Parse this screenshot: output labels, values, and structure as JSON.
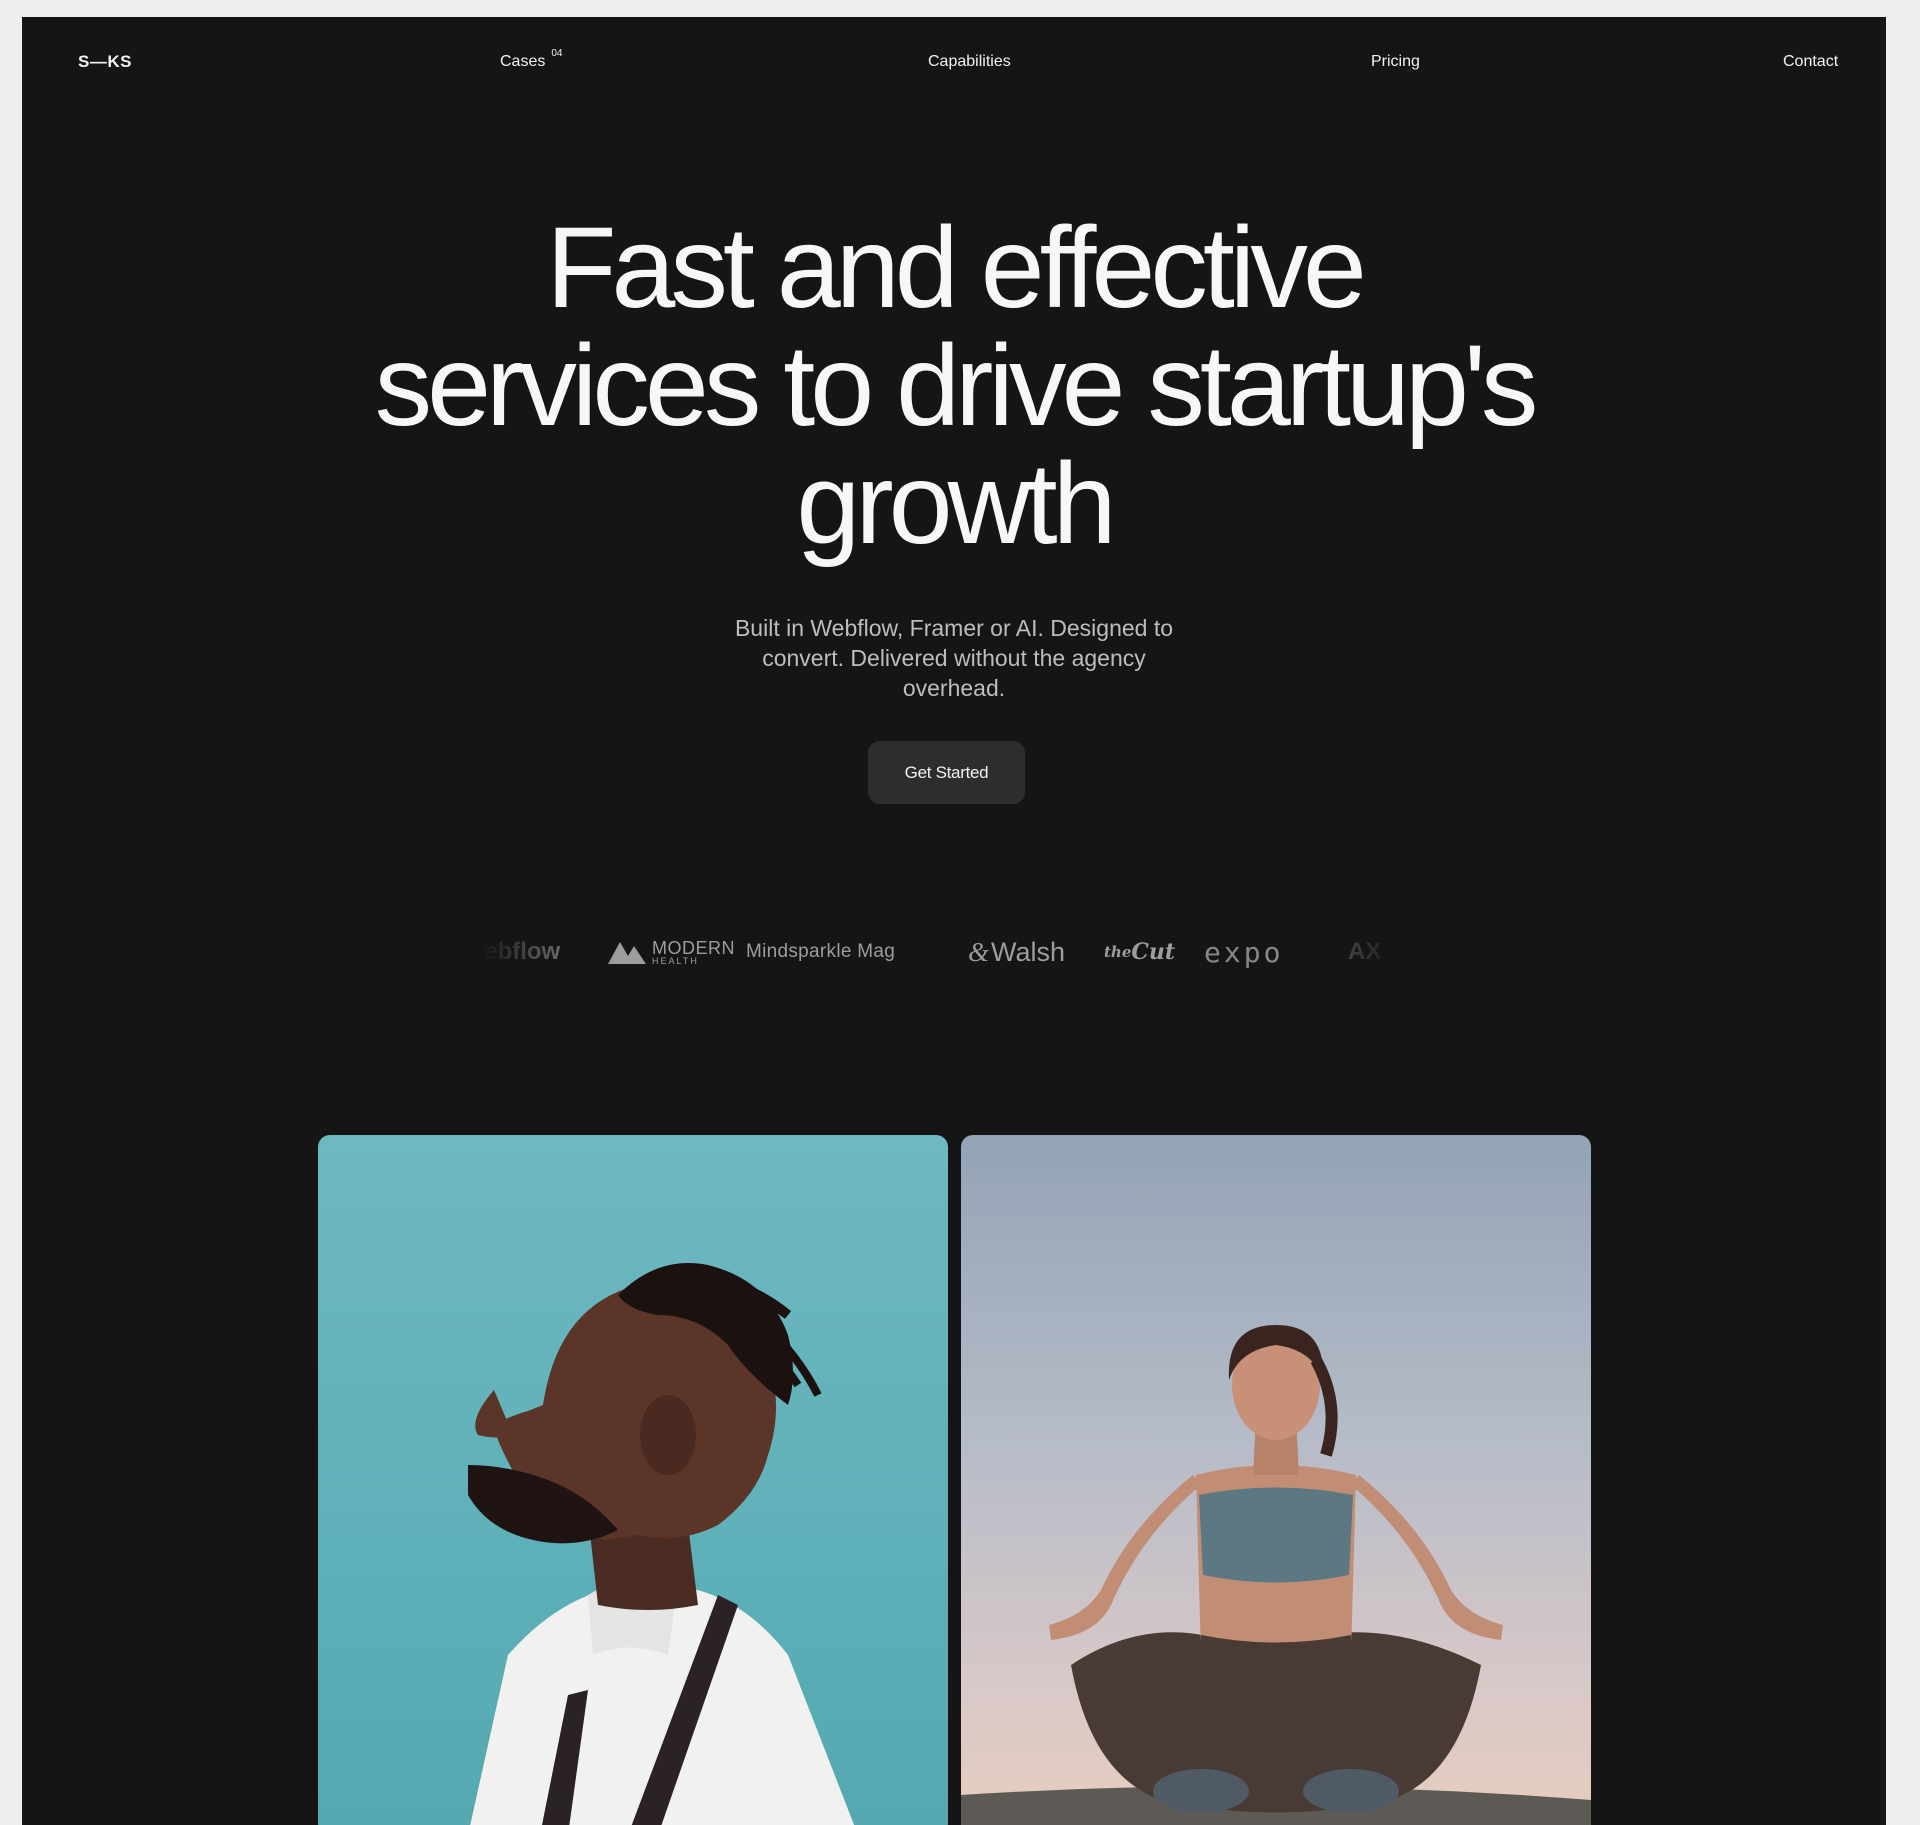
{
  "nav": {
    "logo": "S—KS",
    "cases_label": "Cases",
    "cases_count": "04",
    "capabilities_label": "Capabilities",
    "pricing_label": "Pricing",
    "contact_label": "Contact"
  },
  "hero": {
    "title_lines": [
      "Fast and effective",
      "services to drive startup's",
      "growth"
    ],
    "subtitle": "Built in Webflow, Framer or AI. Designed to convert. Delivered without the agency overhead.",
    "cta_label": "Get Started"
  },
  "clients": {
    "webflow": "Webflow",
    "modern_top": "MODERN",
    "modern_bottom": "HEALTH",
    "mindsparkle": "Mindsparkle Mag",
    "walsh_amp": "&",
    "walsh": "Walsh",
    "cut_the": "the",
    "cut": "Cut",
    "expo": "expo",
    "ax": "AX"
  },
  "colors": {
    "page_bg": "#efeeec",
    "frame_bg": "#161516",
    "button_bg": "#2e2d2e",
    "card_left_bg": "#5eb0b8"
  },
  "showcase": {
    "cards": [
      "profile-portrait-photo",
      "meditation-photo"
    ]
  }
}
